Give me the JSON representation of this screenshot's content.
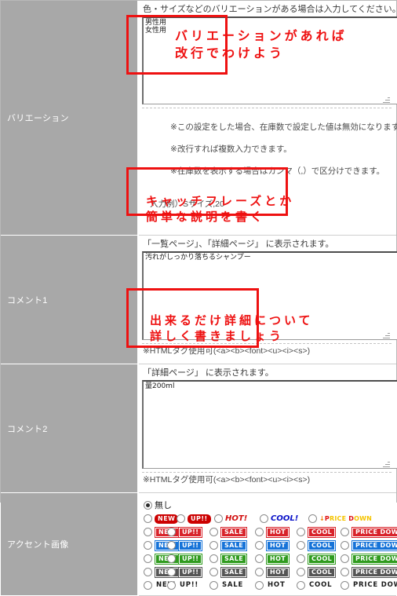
{
  "rows": [
    {
      "label": "バリエーション",
      "hint": "色・サイズなどのバリエーションがある場合は入力してください。",
      "value": "男性用\n女性用",
      "notes_line1": "※この設定をした場合、在庫数で設定した値は無効になります。",
      "notes_line2": "※改行すれば複数入力できます。",
      "notes_line3": "※在庫数を表示する場合はカンマ（,）で区分けできます。",
      "notes_line4": "入力例）Sサイズ,20"
    },
    {
      "label": "コメント1",
      "hint": "「一覧ページ」、「詳細ページ」 に表示されます。",
      "value": "汚れがしっかり落ちるシャンプー",
      "tagnote": "※HTMLタグ使用可(<a><b><font><u><i><s>)"
    },
    {
      "label": "コメント2",
      "hint": "「詳細ページ」 に表示されます。",
      "value": "量200ml",
      "tagnote": "※HTMLタグ使用可(<a><b><font><u><i><s>)"
    }
  ],
  "accent": {
    "label": "アクセント画像",
    "none_label": "無し",
    "none_selected": true,
    "row_styled": [
      {
        "text": "NEW",
        "style": "pill"
      },
      {
        "text": "UP!!",
        "style": "pill"
      },
      {
        "text": "HOT!",
        "style": "text-hot"
      },
      {
        "text": "COOL!",
        "style": "text-cool"
      },
      {
        "text": "PRICE DOWN",
        "style": "price-down",
        "arrow": "↓"
      }
    ],
    "labels": [
      "NEW",
      "UP!!",
      "SALE",
      "HOT",
      "COOL",
      "PRICE DOWN"
    ],
    "color_rows": [
      {
        "name": "red",
        "hex": "#d8232a"
      },
      {
        "name": "blue",
        "hex": "#1673d8"
      },
      {
        "name": "green",
        "hex": "#2f9b1e"
      },
      {
        "name": "gray",
        "hex": "#555555"
      },
      {
        "name": "plain",
        "hex": "#1a1a1a"
      }
    ]
  },
  "annotations": [
    {
      "text": "バリエーションがあれば\n改行でわけよう"
    },
    {
      "text": "キャッチフレーズとか\n簡単な説明を書く"
    },
    {
      "text": "出来るだけ詳細について\n詳しく書きましょう"
    }
  ],
  "colors": {
    "label_bg": "#a8a8a8",
    "label_fg": "#ffffff",
    "annotation": "#ee1111",
    "page_border": "#b9b9b9"
  }
}
